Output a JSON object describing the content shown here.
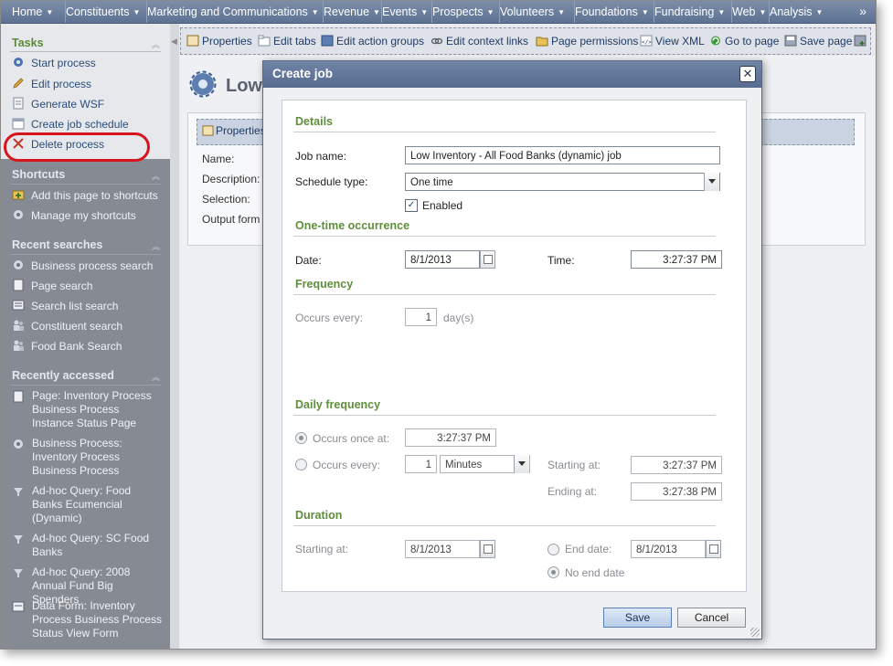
{
  "topnav": {
    "items": [
      "Home",
      "Constituents",
      "Marketing and Communications",
      "Revenue",
      "Events",
      "Prospects",
      "Volunteers",
      "Foundations",
      "Fundraising",
      "Web",
      "Analysis"
    ],
    "more": "»"
  },
  "sidebar": {
    "tasks": {
      "title": "Tasks",
      "items": [
        "Start process",
        "Edit process",
        "Generate WSF",
        "Create job schedule",
        "Delete process"
      ]
    },
    "shortcuts": {
      "title": "Shortcuts",
      "items": [
        "Add this page to shortcuts",
        "Manage my shortcuts"
      ]
    },
    "recent_searches": {
      "title": "Recent searches",
      "items": [
        "Business process search",
        "Page search",
        "Search list search",
        "Constituent search",
        "Food Bank Search"
      ]
    },
    "recently_accessed": {
      "title": "Recently accessed",
      "items": [
        "Page: Inventory Process Business Process Instance Status Page",
        "Business Process: Inventory Process Business Process",
        "Ad-hoc Query: Food Banks Ecumencial (Dynamic)",
        "Ad-hoc Query: SC Food Banks",
        "Ad-hoc Query: 2008 Annual Fund Big Spenders",
        "Data Form: Inventory Process Business Process Status View Form"
      ]
    }
  },
  "toolbar": {
    "items": [
      "Properties",
      "Edit tabs",
      "Edit action groups",
      "Edit context links",
      "Page permissions",
      "View XML",
      "Go to page",
      "Save page"
    ]
  },
  "page": {
    "title": "Low",
    "tab_label": "Properties",
    "labels": [
      "Name:",
      "Description:",
      "Selection:",
      "Output form"
    ]
  },
  "dialog": {
    "title": "Create job",
    "close": "✕",
    "details": {
      "heading": "Details",
      "job_name_label": "Job name:",
      "job_name_value": "Low Inventory - All Food Banks (dynamic) job",
      "schedule_type_label": "Schedule type:",
      "schedule_type_value": "One time",
      "enabled_label": "Enabled",
      "enabled": true
    },
    "one_time": {
      "heading": "One-time occurrence",
      "date_label": "Date:",
      "date_value": "8/1/2013",
      "time_label": "Time:",
      "time_value": "3:27:37 PM"
    },
    "frequency": {
      "heading": "Frequency",
      "occurs_every_label": "Occurs every:",
      "occurs_every_value": "1",
      "unit": "day(s)"
    },
    "daily_frequency": {
      "heading": "Daily frequency",
      "occurs_once_label": "Occurs once at:",
      "occurs_once_value": "3:27:37 PM",
      "occurs_every_label": "Occurs every:",
      "occurs_every_value": "1",
      "interval_unit": "Minutes",
      "starting_label": "Starting at:",
      "starting_value": "3:27:37 PM",
      "ending_label": "Ending at:",
      "ending_value": "3:27:38 PM"
    },
    "duration": {
      "heading": "Duration",
      "starting_label": "Starting at:",
      "starting_value": "8/1/2013",
      "end_date_label": "End date:",
      "end_date_value": "8/1/2013",
      "no_end_date_label": "No end date"
    },
    "buttons": {
      "save": "Save",
      "cancel": "Cancel"
    }
  },
  "colors": {
    "nav_bg": "#6a7e9e",
    "sidebar_bg": "#868b93",
    "section_heading_green": "#5e8e3b",
    "link_blue": "#2b4d7c",
    "highlight_ring": "#d8141c"
  }
}
